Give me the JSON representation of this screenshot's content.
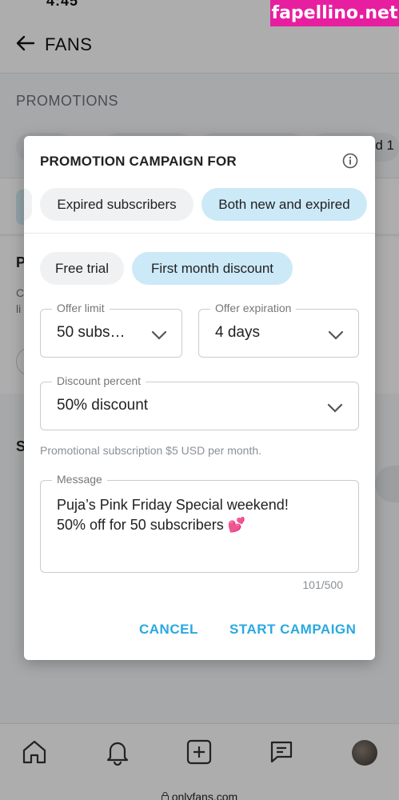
{
  "status": {
    "time": "4:45"
  },
  "watermark": {
    "text": "fapellino.net"
  },
  "header": {
    "title": "FANS"
  },
  "page": {
    "section_label": "PROMOTIONS",
    "chip_partial": "d 1",
    "block_title": "P",
    "block_line1": "C",
    "block_line2": "li",
    "section_s": "S"
  },
  "modal": {
    "title": "PROMOTION CAMPAIGN FOR",
    "audience": [
      {
        "label": "Expired subscribers",
        "selected": false
      },
      {
        "label": "Both new and expired",
        "selected": true
      }
    ],
    "offer_types": [
      {
        "label": "Free trial",
        "selected": false
      },
      {
        "label": "First month discount",
        "selected": true
      }
    ],
    "offer_limit": {
      "label": "Offer limit",
      "value": "50 subs…"
    },
    "offer_expiration": {
      "label": "Offer expiration",
      "value": "4 days"
    },
    "discount": {
      "label": "Discount percent",
      "value": "50% discount"
    },
    "hint": "Promotional subscription $5 USD per month.",
    "message": {
      "label": "Message",
      "line1": "Puja’s Pink Friday Special weekend!",
      "line2": "50% off for 50 subscribers 💕"
    },
    "counter": "101/500",
    "cancel_label": "CANCEL",
    "start_label": "START CAMPAIGN"
  },
  "url": {
    "text": "onlyfans.com"
  },
  "colors": {
    "accent": "#29a9e0",
    "chip_active": "#cce9f8",
    "watermark": "#e81ea0"
  }
}
